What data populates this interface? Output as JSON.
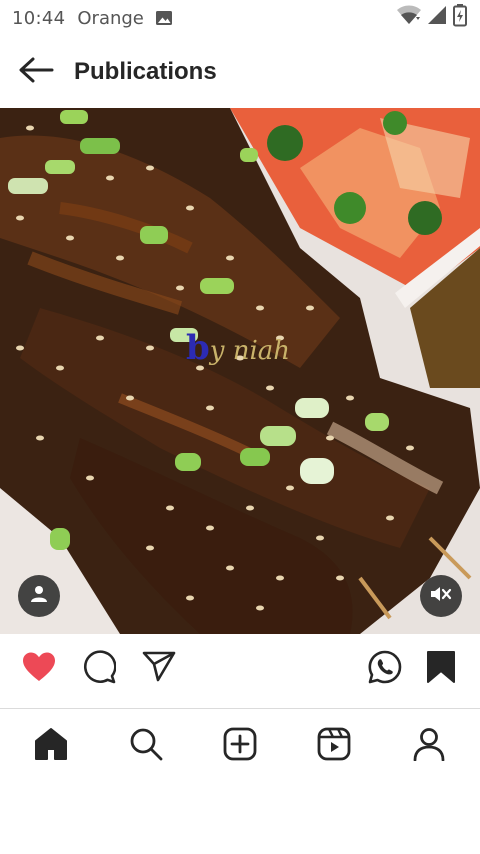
{
  "status_bar": {
    "time": "10:44",
    "carrier": "Orange",
    "icons": [
      "photo-icon",
      "wifi-icon",
      "signal-icon",
      "battery-icon"
    ]
  },
  "header": {
    "title": "Publications",
    "back_icon": "arrow-left-icon"
  },
  "post": {
    "watermark_letter": "b",
    "watermark_rest": "y niah",
    "overlay_left_icon": "person-icon",
    "overlay_right_icon": "muted-speaker-icon"
  },
  "actions": {
    "left": [
      "heart-filled-icon",
      "comment-icon",
      "share-icon"
    ],
    "right": [
      "whatsapp-icon",
      "bookmark-filled-icon"
    ],
    "like_color": "#ed4956"
  },
  "bottom_nav": {
    "items": [
      "home-icon",
      "search-icon",
      "new-post-icon",
      "reels-icon",
      "profile-icon"
    ]
  },
  "colors": {
    "text": "#262626",
    "status_text": "#555555",
    "divider": "#dbdbdb"
  }
}
